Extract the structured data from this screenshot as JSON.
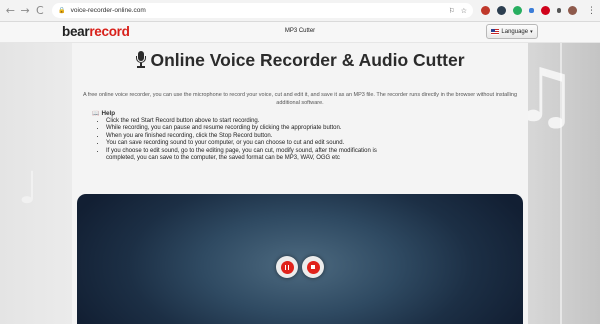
{
  "browser": {
    "url": "voice-recorder-online.com",
    "nav": {
      "back": "←",
      "forward": "→",
      "reload": "C"
    },
    "lock_icon": "lock-icon",
    "menu_icon": "more-vert-icon",
    "extension_colors": [
      "#c0392b",
      "#2c3e50",
      "#27ae60",
      "#3b7dd8",
      "#d0021b",
      "#555555",
      "#8e5a4c"
    ]
  },
  "header": {
    "logo_part1": "bear",
    "logo_part2": "record",
    "nav_link": "MP3 Cutter",
    "language_button": "Language",
    "language_caret": "▾",
    "brand_color": "#d8201a"
  },
  "main": {
    "title": "Online Voice Recorder & Audio Cutter",
    "intro": "A free online voice recorder, you can use the microphone to record your voice, cut and edit it, and save it as an MP3 file. The recorder runs directly in the browser without installing additional software.",
    "help": {
      "icon": "📖",
      "title": "Help",
      "items": [
        "Click the red Start Record button above to start recording.",
        "While recording, you can pause and resume recording by clicking the appropriate button.",
        "When you are finished recording, click the Stop Record button.",
        "You can save recording sound to your computer, or you can choose to cut and edit sound.",
        "If you choose to edit sound, go to the editing page, you can cut, modify sound, after the modification is completed, you can save to the computer, the saved format can be MP3, WAV, OGG etc"
      ]
    }
  },
  "recorder": {
    "pause_icon": "pause-icon",
    "stop_icon": "stop-icon",
    "button_color": "#e0221b"
  }
}
